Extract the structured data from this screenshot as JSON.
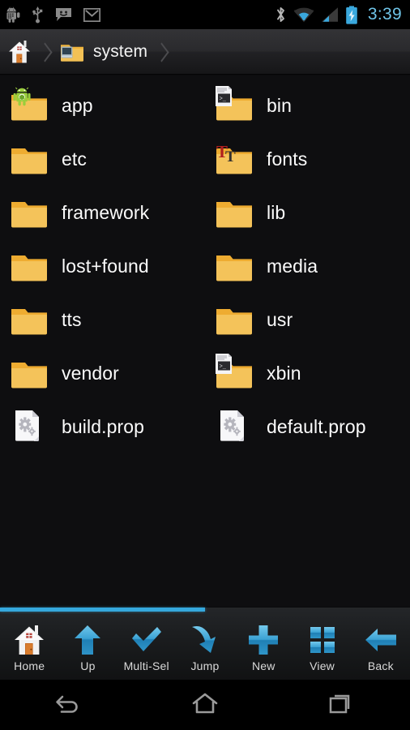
{
  "statusbar": {
    "left_icons": [
      {
        "name": "android-debug-icon",
        "label": "android"
      },
      {
        "name": "usb-icon",
        "label": "usb"
      },
      {
        "name": "sms-icon",
        "label": "messaging"
      },
      {
        "name": "gmail-icon",
        "label": "gmail"
      }
    ],
    "right_icons": [
      {
        "name": "bluetooth-icon",
        "label": "bluetooth"
      },
      {
        "name": "wifi-icon",
        "label": "wifi"
      },
      {
        "name": "cellular-signal-icon",
        "label": "signal"
      },
      {
        "name": "battery-charging-icon",
        "label": "battery charging"
      }
    ],
    "clock": "3:39",
    "clock_color": "#6fc4e8"
  },
  "breadcrumb": {
    "home_icon": "home-icon",
    "crumbs": [
      {
        "icon": "folder-system-icon",
        "label": "system"
      }
    ]
  },
  "files": {
    "rows": [
      [
        {
          "name": "app",
          "icon": "folder-android-icon",
          "type": "folder"
        },
        {
          "name": "bin",
          "icon": "folder-terminal-icon",
          "type": "folder"
        }
      ],
      [
        {
          "name": "etc",
          "icon": "folder-icon",
          "type": "folder"
        },
        {
          "name": "fonts",
          "icon": "folder-fonts-icon",
          "type": "folder"
        }
      ],
      [
        {
          "name": "framework",
          "icon": "folder-icon",
          "type": "folder"
        },
        {
          "name": "lib",
          "icon": "folder-icon",
          "type": "folder"
        }
      ],
      [
        {
          "name": "lost+found",
          "icon": "folder-icon",
          "type": "folder"
        },
        {
          "name": "media",
          "icon": "folder-icon",
          "type": "folder"
        }
      ],
      [
        {
          "name": "tts",
          "icon": "folder-icon",
          "type": "folder"
        },
        {
          "name": "usr",
          "icon": "folder-icon",
          "type": "folder"
        }
      ],
      [
        {
          "name": "vendor",
          "icon": "folder-icon",
          "type": "folder"
        },
        {
          "name": "xbin",
          "icon": "folder-terminal-icon",
          "type": "folder"
        }
      ],
      [
        {
          "name": "build.prop",
          "icon": "file-properties-icon",
          "type": "file"
        },
        {
          "name": "default.prop",
          "icon": "file-properties-icon",
          "type": "file"
        }
      ]
    ]
  },
  "toolbar": {
    "accent_color": "#35a8dd",
    "progress_percent": 50,
    "items": [
      {
        "label": "Home",
        "icon": "home-icon"
      },
      {
        "label": "Up",
        "icon": "arrow-up-icon"
      },
      {
        "label": "Multi-Sel",
        "icon": "checkmark-icon"
      },
      {
        "label": "Jump",
        "icon": "jump-arrow-icon"
      },
      {
        "label": "New",
        "icon": "plus-icon"
      },
      {
        "label": "View",
        "icon": "grid-view-icon"
      },
      {
        "label": "Back",
        "icon": "arrow-left-icon"
      }
    ]
  },
  "navbar": {
    "buttons": [
      {
        "name": "back",
        "icon": "nav-back-icon"
      },
      {
        "name": "home",
        "icon": "nav-home-icon"
      },
      {
        "name": "recents",
        "icon": "nav-recents-icon"
      }
    ]
  }
}
